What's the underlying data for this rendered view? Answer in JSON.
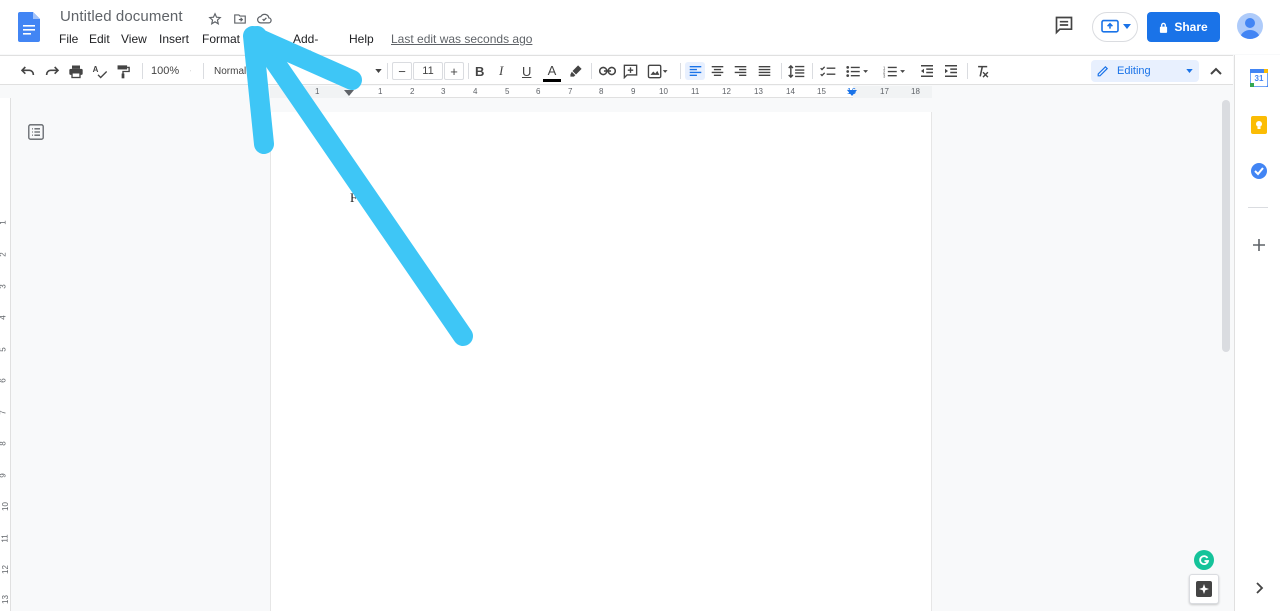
{
  "document": {
    "title": "Untitled document",
    "body_text": "F"
  },
  "menu": {
    "file": "File",
    "edit": "Edit",
    "view": "View",
    "insert": "Insert",
    "format": "Format",
    "addons": "Add-ons",
    "help": "Help",
    "last_edit": "Last edit was seconds ago"
  },
  "header": {
    "share_label": "Share"
  },
  "toolbar": {
    "zoom": "100%",
    "style": "Normal",
    "font_size": "11",
    "font_size_minus": "−",
    "font_size_plus": "+",
    "bold": "B",
    "italic": "I",
    "underline": "U",
    "text_color": "A",
    "mode": "Editing"
  },
  "ruler": {
    "horizontal": [
      "1",
      "1",
      "2",
      "3",
      "4",
      "5",
      "6",
      "7",
      "8",
      "9",
      "10",
      "11",
      "12",
      "13",
      "14",
      "15",
      "16",
      "17",
      "18"
    ],
    "vertical": [
      "1",
      "2",
      "3",
      "4",
      "5",
      "6",
      "7",
      "8",
      "9",
      "10",
      "11",
      "12",
      "13"
    ]
  },
  "side_panel": {
    "calendar_day": "31"
  },
  "colors": {
    "accent": "#1a73e8",
    "annotation_arrow": "#3ec6f6",
    "keep": "#fbbc04",
    "grammarly": "#15c39a"
  }
}
